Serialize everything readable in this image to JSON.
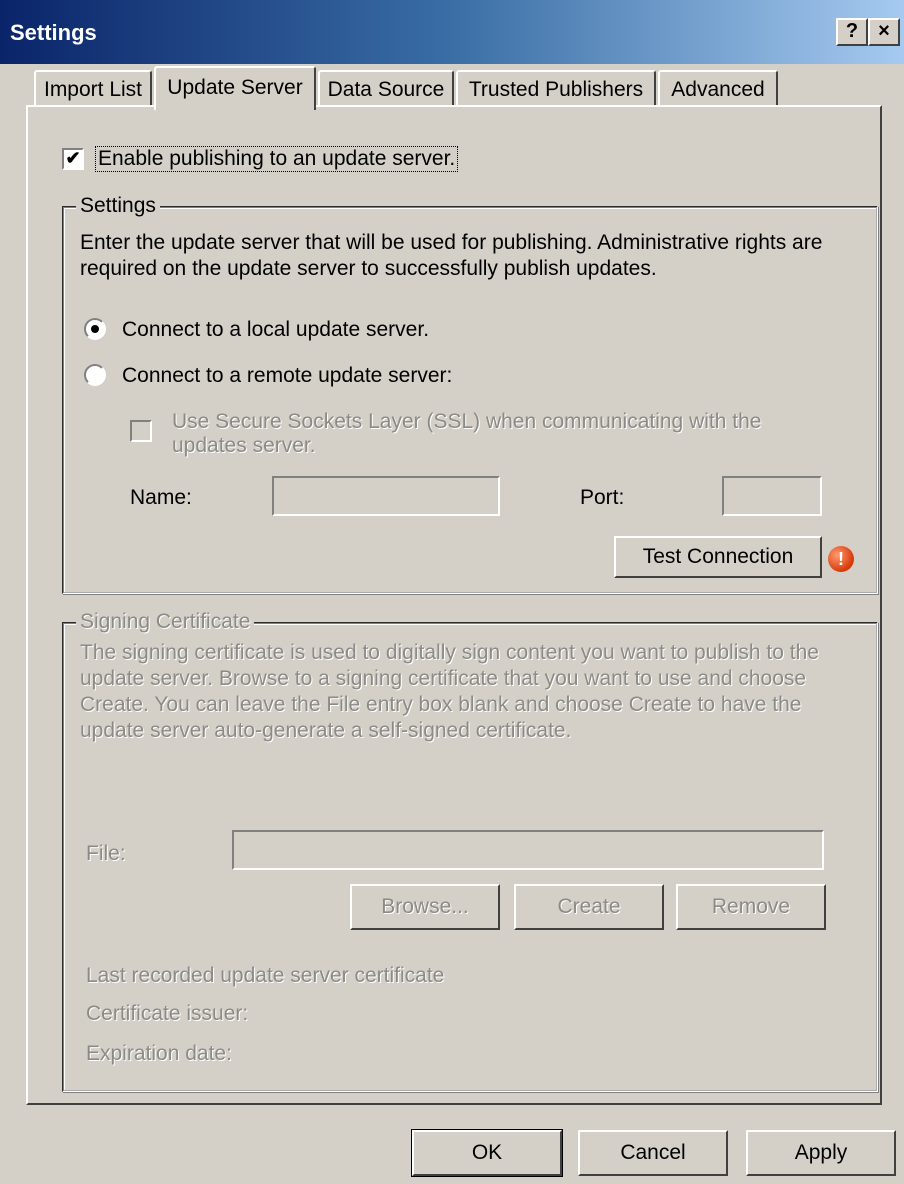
{
  "window": {
    "title": "Settings",
    "help_label": "?",
    "close_label": "×"
  },
  "tabs": [
    {
      "label": "Import List"
    },
    {
      "label": "Update Server"
    },
    {
      "label": "Data Source"
    },
    {
      "label": "Trusted Publishers"
    },
    {
      "label": "Advanced"
    }
  ],
  "enable_checkbox": {
    "label": "Enable publishing to an update server.",
    "checked": true
  },
  "settings_group": {
    "title": "Settings",
    "description_line1": "Enter the update server that will be used for publishing.  Administrative rights are",
    "description_line2": "required on the update server to successfully publish updates.",
    "radio_local": "Connect to a local update server.",
    "radio_remote": "Connect to a remote update server:",
    "ssl_line1": "Use Secure Sockets Layer (SSL) when communicating with the",
    "ssl_line2": "updates server.",
    "name_label": "Name:",
    "name_value": "",
    "port_label": "Port:",
    "port_value": "",
    "test_button": "Test Connection"
  },
  "signing_group": {
    "title": "Signing Certificate",
    "desc_line1": "The signing certificate is used to digitally sign content you want to publish to the",
    "desc_line2": "update server. Browse to a signing certificate that you want to use and choose",
    "desc_line3": "Create. You can leave the File entry box blank and choose Create to have the",
    "desc_line4": "update server auto-generate a self-signed certificate.",
    "file_label": "File:",
    "file_value": "",
    "browse_button": "Browse...",
    "create_button": "Create",
    "remove_button": "Remove",
    "last_recorded": "Last recorded update server certificate",
    "issuer": "Certificate issuer:",
    "expiration": "Expiration date:"
  },
  "footer": {
    "ok": "OK",
    "cancel": "Cancel",
    "apply": "Apply"
  },
  "icons": {
    "warning": "exclamation-warning-icon"
  },
  "colors": {
    "title_start": "#0a246a",
    "title_end": "#a6caf0",
    "face": "#d4d0c8",
    "disabled_text": "#8c8a86",
    "warning": "#d63a0a"
  }
}
